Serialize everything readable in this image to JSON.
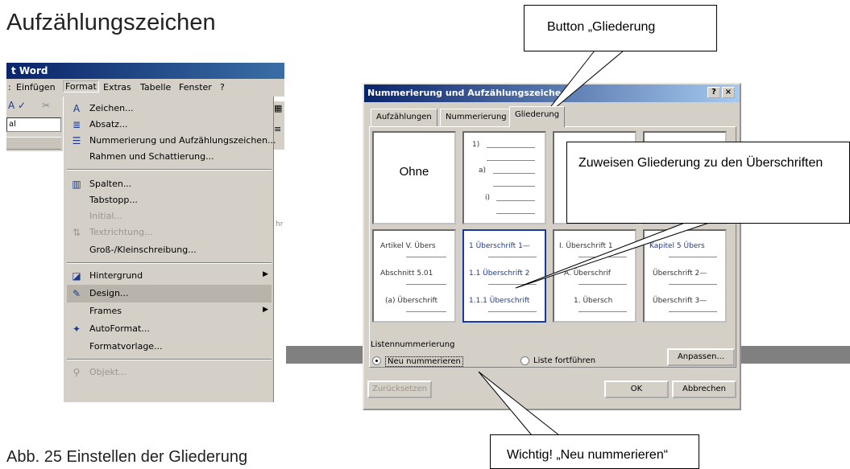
{
  "heading": "Aufzählungszeichen",
  "caption": "Abb. 25 Einstellen der Gliederung",
  "word": {
    "title": "t Word",
    "menubar": [
      "Einfügen",
      "Format",
      "Extras",
      "Tabelle",
      "Fenster",
      "?"
    ],
    "toolbar_field": "al",
    "format_menu": [
      {
        "label": "Zeichen...",
        "icon": "font-a-icon"
      },
      {
        "label": "Absatz...",
        "icon": "paragraph-icon"
      },
      {
        "label": "Nummerierung und Aufzählungszeichen...",
        "icon": "bullet-list-icon"
      },
      {
        "label": "Rahmen und Schattierung..."
      },
      {
        "label": "Spalten...",
        "icon": "columns-icon"
      },
      {
        "label": "Tabstopp..."
      },
      {
        "label": "Initial..."
      },
      {
        "label": "Textrichtung...",
        "icon": "text-direction-icon"
      },
      {
        "label": "Groß-/Kleinschreibung..."
      },
      {
        "label": "Hintergrund",
        "icon": "background-icon"
      },
      {
        "label": "Design...",
        "icon": "design-icon"
      },
      {
        "label": "Frames"
      },
      {
        "label": "AutoFormat...",
        "icon": "autoformat-icon"
      },
      {
        "label": "Formatvorlage..."
      },
      {
        "label": "Objekt...",
        "icon": "object-icon"
      }
    ],
    "right_text": "hr"
  },
  "dialog": {
    "title": "Nummerierung und Aufzählungszeiche",
    "help_btn": "?",
    "close_btn": "×",
    "tabs": [
      "Aufzählungen",
      "Nummerierung",
      "Gliederung"
    ],
    "cells_top": [
      {
        "text": [
          "Ohne"
        ]
      },
      {
        "text": [
          "1)",
          "a)",
          "i)"
        ]
      },
      {
        "text": []
      },
      {
        "text": []
      }
    ],
    "cells_bottom": [
      {
        "text": [
          "Artikel V. Übers",
          "Abschnitt 5.01",
          "(a) Überschrift"
        ]
      },
      {
        "text": [
          "1 Überschrift 1—",
          "1.1 Überschrift 2",
          "1.1.1 Überschrift"
        ]
      },
      {
        "text": [
          "I. Überschrift 1",
          "A. Überschrif",
          "1. Übersch"
        ]
      },
      {
        "text": [
          "Kapitel 5 Übers",
          "Überschrift 2—",
          "Überschrift 3—"
        ]
      }
    ],
    "group_label": "Listennummerierung",
    "radio_restart": "Neu nummerieren",
    "radio_continue": "Liste fortführen",
    "btn_customize": "Anpassen...",
    "btn_reset": "Zurücksetzen",
    "btn_ok": "OK",
    "btn_cancel": "Abbrechen"
  },
  "callouts": {
    "gliederung": "Button „Gliederung",
    "zuweisen": "Zuweisen Gliederung zu den Überschriften",
    "wichtig": "Wichtig! „Neu nummerieren“"
  }
}
